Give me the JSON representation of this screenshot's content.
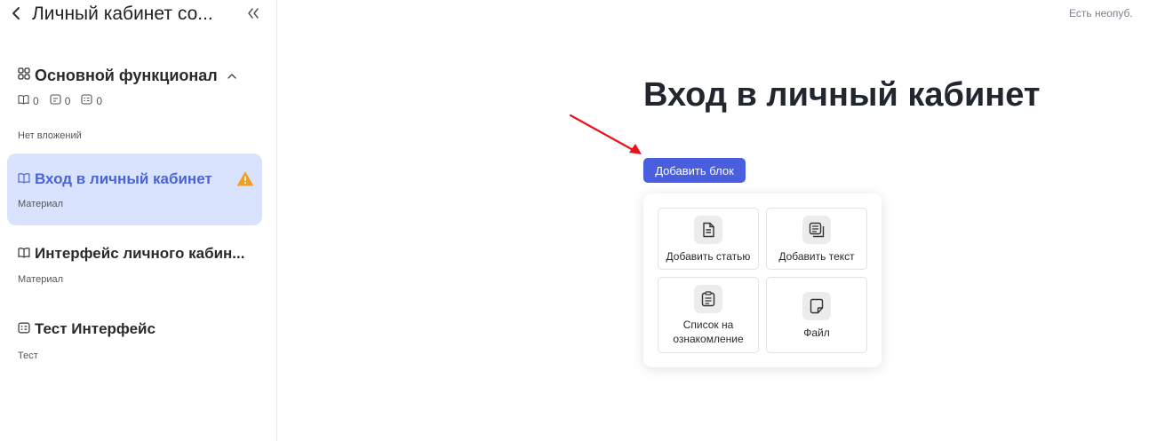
{
  "sidebar": {
    "title": "Личный кабинет со...",
    "section": {
      "title": "Основной функционал",
      "counts": [
        "0",
        "0",
        "0"
      ],
      "no_attachments": "Нет вложений"
    },
    "items": [
      {
        "title": "Вход в личный кабинет",
        "subtitle": "Материал",
        "icon": "book-icon",
        "active": true,
        "warning": true
      },
      {
        "title": "Интерфейс личного кабин...",
        "subtitle": "Материал",
        "icon": "book-icon",
        "active": false
      },
      {
        "title": "Тест Интерфейс",
        "subtitle": "Тест",
        "icon": "test-icon",
        "active": false
      }
    ]
  },
  "header": {
    "status": "Есть неопуб."
  },
  "main": {
    "title": "Вход в личный кабинет",
    "add_block_label": "Добавить блок",
    "popup": {
      "options": [
        {
          "label": "Добавить статью",
          "icon": "article-icon"
        },
        {
          "label": "Добавить текст",
          "icon": "text-icon"
        },
        {
          "label": "Список на ознакомление",
          "icon": "clipboard-icon"
        },
        {
          "label": "Файл",
          "icon": "file-icon"
        }
      ]
    }
  },
  "colors": {
    "accent": "#4a5fe0",
    "active_bg": "#dae3fd",
    "active_text": "#4a64d6",
    "warning": "#f0a020",
    "annotation_arrow": "#e8141c"
  }
}
